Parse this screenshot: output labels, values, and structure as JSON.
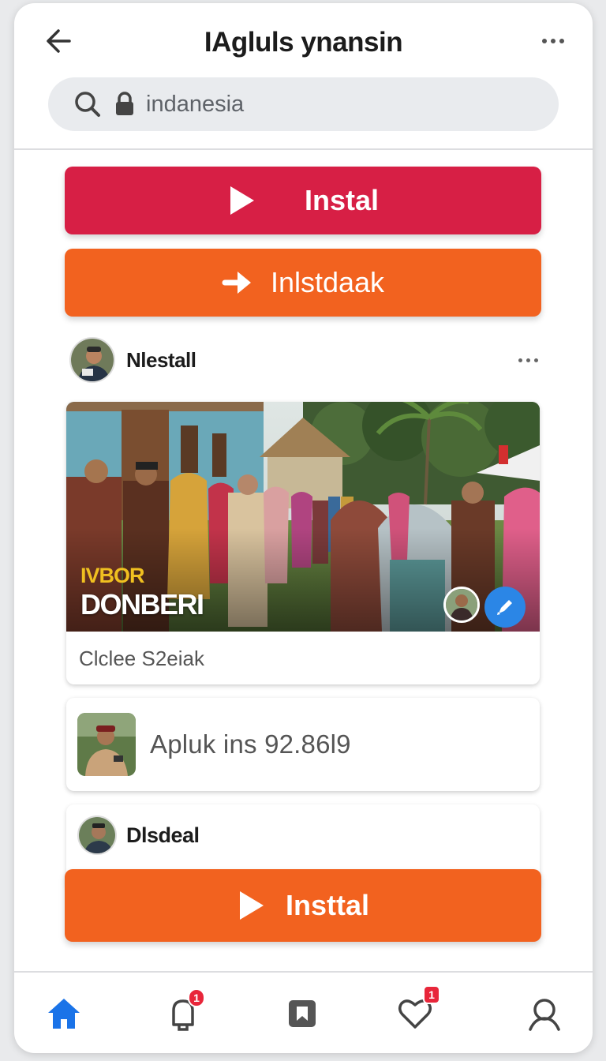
{
  "header": {
    "title": "IAgluls ynansin"
  },
  "search": {
    "value": "indanesia"
  },
  "buttons": {
    "install_red": "Instal",
    "install_orange": "Inlstdaak",
    "install_bottom": "Insttal"
  },
  "post": {
    "author": "Nlestall",
    "image_overlay_line1": "IVBOR",
    "image_overlay_line2": "DONBERI",
    "caption": "Clclee S2eiak"
  },
  "list_item": {
    "text": "Apluk ins 92.86l9"
  },
  "post2": {
    "author": "Dlsdeal"
  },
  "nav": {
    "notifications_badge": "1",
    "likes_badge": "1",
    "active_color": "#1a73e8"
  },
  "colors": {
    "red_button": "#d71f45",
    "orange_button": "#f2621f",
    "edit_button": "#2b86e6"
  }
}
